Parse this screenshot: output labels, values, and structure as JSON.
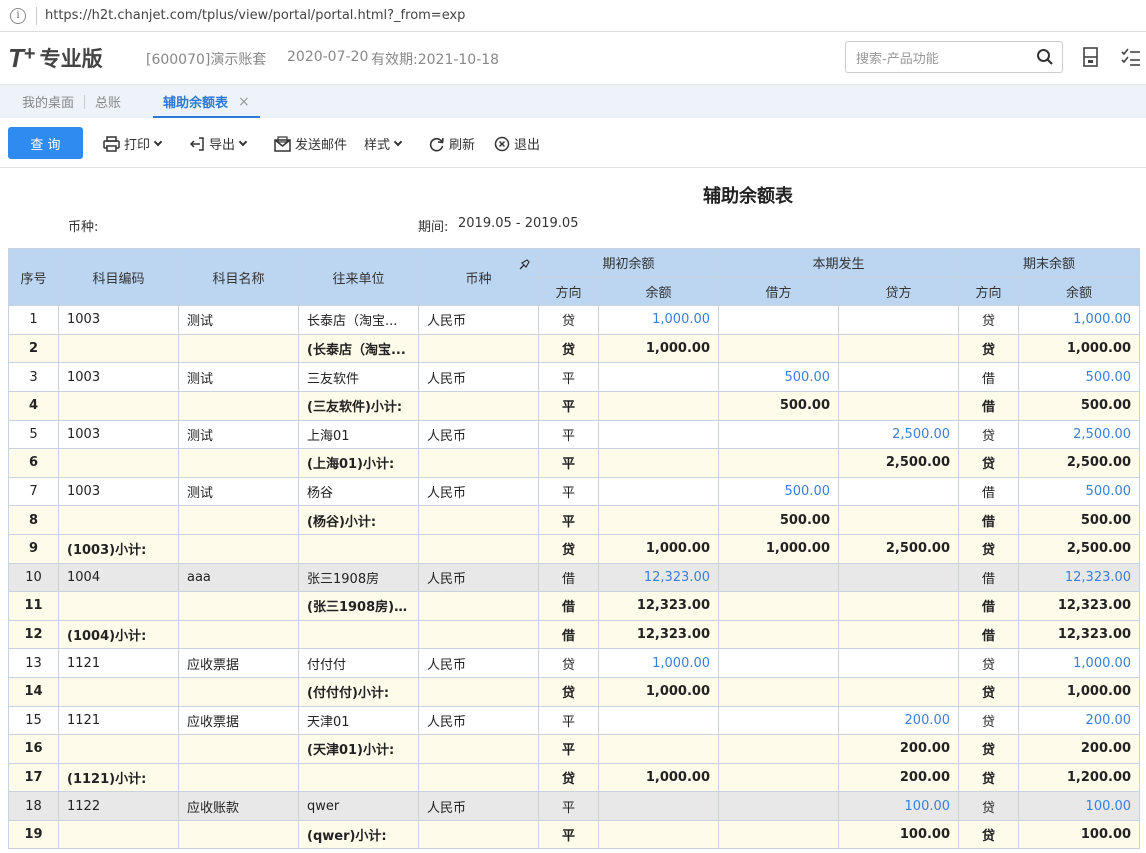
{
  "browser": {
    "url": "https://h2t.chanjet.com/tplus/view/portal/portal.html?_from=exp",
    "info_glyph": "i"
  },
  "header": {
    "logo_t": "T",
    "logo_plus": "+",
    "logo_name": "专业版",
    "account": "[600070]演示账套",
    "date": "2020-07-20",
    "validity": "有效期:2021-10-18",
    "search_placeholder": "搜索-产品功能"
  },
  "tabs": [
    {
      "label": "我的桌面"
    },
    {
      "label": "总账"
    },
    {
      "label": "辅助余额表",
      "close": "×"
    }
  ],
  "toolbar": {
    "query": "查 询",
    "print": "打印",
    "export": "导出",
    "email": "发送邮件",
    "style": "样式",
    "refresh": "刷新",
    "exit": "退出"
  },
  "report": {
    "title": "辅助余额表",
    "currency_label": "币种:",
    "period_label": "期间:",
    "period_value": "2019.05 - 2019.05"
  },
  "table": {
    "headers": {
      "seq": "序号",
      "code": "科目编码",
      "name": "科目名称",
      "unit": "往来单位",
      "currency": "币种",
      "opening": "期初余额",
      "current": "本期发生",
      "closing": "期末余额",
      "direction": "方向",
      "balance": "余额",
      "debit": "借方",
      "credit": "贷方"
    },
    "rows": [
      {
        "seq": "1",
        "code": "1003",
        "name": "测试",
        "unit": "长泰店（淘宝...",
        "currency": "人民币",
        "od": "贷",
        "ob": "1,000.00",
        "debit": "",
        "credit": "",
        "cd": "贷",
        "cb": "1,000.00",
        "type": "normal"
      },
      {
        "seq": "2",
        "code": "",
        "name": "",
        "unit": "(长泰店（淘宝...",
        "currency": "",
        "od": "贷",
        "ob": "1,000.00",
        "debit": "",
        "credit": "",
        "cd": "贷",
        "cb": "1,000.00",
        "type": "sub"
      },
      {
        "seq": "3",
        "code": "1003",
        "name": "测试",
        "unit": "三友软件",
        "currency": "人民币",
        "od": "平",
        "ob": "",
        "debit": "500.00",
        "credit": "",
        "cd": "借",
        "cb": "500.00",
        "type": "normal"
      },
      {
        "seq": "4",
        "code": "",
        "name": "",
        "unit": "(三友软件)小计:",
        "currency": "",
        "od": "平",
        "ob": "",
        "debit": "500.00",
        "credit": "",
        "cd": "借",
        "cb": "500.00",
        "type": "sub"
      },
      {
        "seq": "5",
        "code": "1003",
        "name": "测试",
        "unit": "上海01",
        "currency": "人民币",
        "od": "平",
        "ob": "",
        "debit": "",
        "credit": "2,500.00",
        "cd": "贷",
        "cb": "2,500.00",
        "type": "normal"
      },
      {
        "seq": "6",
        "code": "",
        "name": "",
        "unit": "(上海01)小计:",
        "currency": "",
        "od": "平",
        "ob": "",
        "debit": "",
        "credit": "2,500.00",
        "cd": "贷",
        "cb": "2,500.00",
        "type": "sub"
      },
      {
        "seq": "7",
        "code": "1003",
        "name": "测试",
        "unit": "杨谷",
        "currency": "人民币",
        "od": "平",
        "ob": "",
        "debit": "500.00",
        "credit": "",
        "cd": "借",
        "cb": "500.00",
        "type": "normal"
      },
      {
        "seq": "8",
        "code": "",
        "name": "",
        "unit": "(杨谷)小计:",
        "currency": "",
        "od": "平",
        "ob": "",
        "debit": "500.00",
        "credit": "",
        "cd": "借",
        "cb": "500.00",
        "type": "sub"
      },
      {
        "seq": "9",
        "code": "(1003)小计:",
        "name": "",
        "unit": "",
        "currency": "",
        "od": "贷",
        "ob": "1,000.00",
        "debit": "1,000.00",
        "credit": "2,500.00",
        "cd": "贷",
        "cb": "2,500.00",
        "type": "sub"
      },
      {
        "seq": "10",
        "code": "1004",
        "name": "aaa",
        "unit": "张三1908房",
        "currency": "人民币",
        "od": "借",
        "ob": "12,323.00",
        "debit": "",
        "credit": "",
        "cd": "借",
        "cb": "12,323.00",
        "type": "gray"
      },
      {
        "seq": "11",
        "code": "",
        "name": "",
        "unit": "(张三1908房)小...",
        "currency": "",
        "od": "借",
        "ob": "12,323.00",
        "debit": "",
        "credit": "",
        "cd": "借",
        "cb": "12,323.00",
        "type": "sub"
      },
      {
        "seq": "12",
        "code": "(1004)小计:",
        "name": "",
        "unit": "",
        "currency": "",
        "od": "借",
        "ob": "12,323.00",
        "debit": "",
        "credit": "",
        "cd": "借",
        "cb": "12,323.00",
        "type": "sub"
      },
      {
        "seq": "13",
        "code": "1121",
        "name": "应收票据",
        "unit": "付付付",
        "currency": "人民币",
        "od": "贷",
        "ob": "1,000.00",
        "debit": "",
        "credit": "",
        "cd": "贷",
        "cb": "1,000.00",
        "type": "normal"
      },
      {
        "seq": "14",
        "code": "",
        "name": "",
        "unit": "(付付付)小计:",
        "currency": "",
        "od": "贷",
        "ob": "1,000.00",
        "debit": "",
        "credit": "",
        "cd": "贷",
        "cb": "1,000.00",
        "type": "sub"
      },
      {
        "seq": "15",
        "code": "1121",
        "name": "应收票据",
        "unit": "天津01",
        "currency": "人民币",
        "od": "平",
        "ob": "",
        "debit": "",
        "credit": "200.00",
        "cd": "贷",
        "cb": "200.00",
        "type": "normal"
      },
      {
        "seq": "16",
        "code": "",
        "name": "",
        "unit": "(天津01)小计:",
        "currency": "",
        "od": "平",
        "ob": "",
        "debit": "",
        "credit": "200.00",
        "cd": "贷",
        "cb": "200.00",
        "type": "sub"
      },
      {
        "seq": "17",
        "code": "(1121)小计:",
        "name": "",
        "unit": "",
        "currency": "",
        "od": "贷",
        "ob": "1,000.00",
        "debit": "",
        "credit": "200.00",
        "cd": "贷",
        "cb": "1,200.00",
        "type": "sub"
      },
      {
        "seq": "18",
        "code": "1122",
        "name": "应收账款",
        "unit": "qwer",
        "currency": "人民币",
        "od": "平",
        "ob": "",
        "debit": "",
        "credit": "100.00",
        "cd": "贷",
        "cb": "100.00",
        "type": "gray"
      },
      {
        "seq": "19",
        "code": "",
        "name": "",
        "unit": "(qwer)小计:",
        "currency": "",
        "od": "平",
        "ob": "",
        "debit": "",
        "credit": "100.00",
        "cd": "贷",
        "cb": "100.00",
        "type": "sub"
      }
    ]
  }
}
